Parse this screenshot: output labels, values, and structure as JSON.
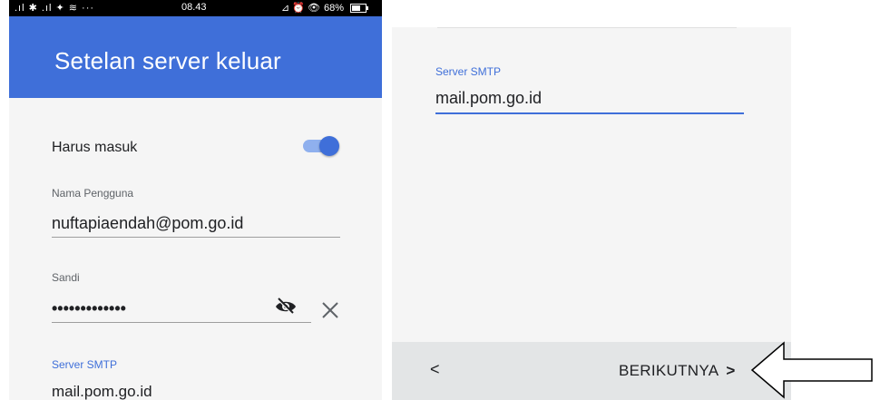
{
  "status_bar": {
    "signal_text": ".ıl ✱ .ıl ✦ ≋ ···",
    "time": "08.43",
    "right_icons_text": "⊿ ⏰ 👁",
    "battery": "68%"
  },
  "app_bar": {
    "title": "Setelan server keluar"
  },
  "form": {
    "toggle_label": "Harus masuk",
    "toggle_on": true,
    "username_label": "Nama Pengguna",
    "username_value": "nuftapiaendah@pom.go.id",
    "password_label": "Sandi",
    "password_value": "•••••••••••••",
    "smtp_label": "Server SMTP",
    "smtp_value": "mail.pom.go.id"
  },
  "right_form": {
    "smtp_label": "Server SMTP",
    "smtp_value": "mail.pom.go.id"
  },
  "navigation": {
    "back_label": "<",
    "next_label": "BERIKUTNYA",
    "next_chevron": ">"
  },
  "colors": {
    "accent": "#3f6fd9",
    "toggle_track": "#8fb0ee",
    "background": "#f5f5f5",
    "bottom_bar": "#e3e5e6"
  },
  "icons": [
    "eye-off-icon",
    "close-icon",
    "callout-arrow-icon",
    "battery-icon"
  ]
}
